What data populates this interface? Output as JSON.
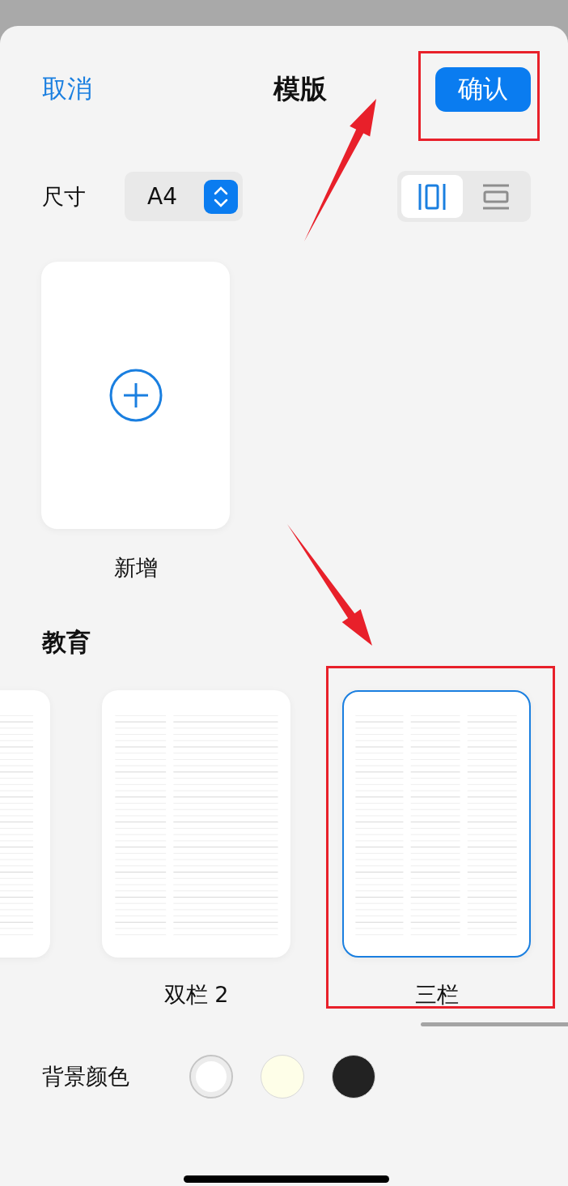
{
  "header": {
    "cancel": "取消",
    "title": "模版",
    "confirm": "确认"
  },
  "size": {
    "label": "尺寸",
    "value": "A4"
  },
  "orientation": [
    {
      "kind": "portrait",
      "selected": true
    },
    {
      "kind": "landscape",
      "selected": false
    }
  ],
  "new_template": {
    "label": "新增"
  },
  "section": {
    "title": "教育",
    "templates": [
      {
        "kind": "single",
        "selected": false
      },
      {
        "kind": "double",
        "label": "双栏 2",
        "selected": false
      },
      {
        "kind": "triple",
        "label": "三栏",
        "selected": true
      }
    ]
  },
  "background": {
    "label": "背景颜色",
    "swatches": [
      {
        "color": "#ffffff",
        "selected": true
      },
      {
        "color": "#fefee8",
        "selected": false
      },
      {
        "color": "#222222",
        "selected": false
      }
    ]
  }
}
